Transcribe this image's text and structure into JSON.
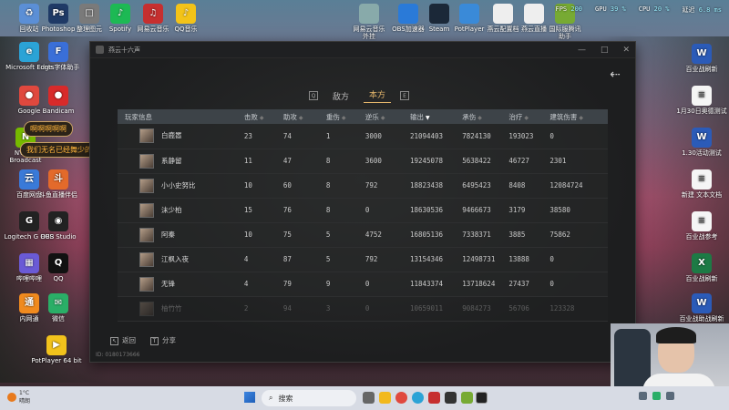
{
  "desktop_icons": [
    {
      "id": "recycle",
      "label": "回收站",
      "color": "#5b8fd6",
      "glyph": "♻"
    },
    {
      "id": "photoshop",
      "label": "Photoshop",
      "color": "#1f3a66",
      "glyph": "Ps"
    },
    {
      "id": "zhengli",
      "label": "整理图元",
      "color": "#7a7a7a",
      "glyph": "□"
    },
    {
      "id": "spotify",
      "label": "Spotify",
      "color": "#1db954",
      "glyph": "♪"
    },
    {
      "id": "netease",
      "label": "网易云音乐",
      "color": "#c62f2f",
      "glyph": "♫"
    },
    {
      "id": "qqmusic",
      "label": "QQ音乐",
      "color": "#f3c318",
      "glyph": "♪"
    },
    {
      "id": "edge",
      "label": "Microsoft Edge",
      "color": "#2ba3d6",
      "glyph": "e"
    },
    {
      "id": "fonts",
      "label": "Fonts字体助手",
      "color": "#3a6fd8",
      "glyph": "F"
    },
    {
      "id": "chrome",
      "label": "Google",
      "color": "#e0483e",
      "glyph": "●"
    },
    {
      "id": "bandicam",
      "label": "Bandicam",
      "color": "#d82a2a",
      "glyph": "●"
    },
    {
      "id": "nvidia",
      "label": "NVIDIA Broadcast",
      "color": "#76b900",
      "glyph": "N"
    },
    {
      "id": "baidu",
      "label": "百度网盘",
      "color": "#3a7ad8",
      "glyph": "云"
    },
    {
      "id": "mahjong",
      "label": "斗鱼直播伴侣",
      "color": "#e36a2b",
      "glyph": "斗"
    },
    {
      "id": "logitech",
      "label": "Logitech G HUB",
      "color": "#222",
      "glyph": "G"
    },
    {
      "id": "obs",
      "label": "OBS Studio",
      "color": "#222",
      "glyph": "◉"
    },
    {
      "id": "bilimini",
      "label": "哔哩哔哩",
      "color": "#6a5ad6",
      "glyph": "▦"
    },
    {
      "id": "qq",
      "label": "QQ",
      "color": "#111",
      "glyph": "Q"
    },
    {
      "id": "neijiang",
      "label": "内网通",
      "color": "#f08a1e",
      "glyph": "通"
    },
    {
      "id": "wechat",
      "label": "微信",
      "color": "#2aae67",
      "glyph": "✉"
    },
    {
      "id": "potplayer",
      "label": "PotPlayer 64 bit",
      "color": "#f2c21c",
      "glyph": "▶"
    }
  ],
  "top_bar_icons": [
    {
      "id": "tb1",
      "label": "网易云音乐外挂"
    },
    {
      "id": "tb2",
      "label": "OBS加速器"
    },
    {
      "id": "tb3",
      "label": "Steam"
    },
    {
      "id": "tb4",
      "label": "PotPlayer"
    },
    {
      "id": "tb5",
      "label": "燕云配置档"
    },
    {
      "id": "tb6",
      "label": "燕云直播"
    },
    {
      "id": "tb7",
      "label": "国际服腾讯助手"
    }
  ],
  "right_icons": [
    {
      "id": "r1",
      "label": "百业战刷新",
      "type": "word"
    },
    {
      "id": "r2",
      "label": "1月30日奥德测试",
      "type": "doc"
    },
    {
      "id": "r3",
      "label": "1.30活动测试",
      "type": "word"
    },
    {
      "id": "r4",
      "label": "新建 文本文档",
      "type": "doc"
    },
    {
      "id": "r5",
      "label": "百业战参考",
      "type": "doc"
    },
    {
      "id": "r6",
      "label": "百业战刷新",
      "type": "excel"
    },
    {
      "id": "r7",
      "label": "百业战助战刷新",
      "type": "word"
    }
  ],
  "sysstat": {
    "fps_label": "FPS",
    "fps": "200",
    "gpu_label": "GPU",
    "gpu": "39 %",
    "cpu_label": "CPU",
    "cpu": "20 %",
    "latency_label": "延迟",
    "latency": "6.8 ms"
  },
  "overlays": {
    "bubble1": "啊啊啊啊啊",
    "bubble2": "我们无名已经舞少的了"
  },
  "window": {
    "title": "燕云十六声",
    "minimize": "—",
    "maximize": "□",
    "close": "✕"
  },
  "tabs": {
    "key_left": "Q",
    "enemy": "敌方",
    "ours": "本方",
    "key_right": "E"
  },
  "table": {
    "headers": [
      "玩家信息",
      "击败",
      "助攻",
      "重伤",
      "逆乐",
      "输出",
      "承伤",
      "治疗",
      "建筑伤害"
    ],
    "rows": [
      {
        "name": "白鹿嚣",
        "kills": "23",
        "assists": "74",
        "downs": "1",
        "revive": "3000",
        "output": "21094403",
        "taken": "7824130",
        "heal": "193023",
        "building": "0"
      },
      {
        "name": "系静留",
        "kills": "11",
        "assists": "47",
        "downs": "8",
        "revive": "3600",
        "output": "19245078",
        "taken": "5638422",
        "heal": "46727",
        "building": "2301"
      },
      {
        "name": "小小史努比",
        "kills": "10",
        "assists": "60",
        "downs": "8",
        "revive": "792",
        "output": "18823438",
        "taken": "6495423",
        "heal": "8408",
        "building": "12084724"
      },
      {
        "name": "沫少柏",
        "kills": "15",
        "assists": "76",
        "downs": "8",
        "revive": "0",
        "output": "18630536",
        "taken": "9466673",
        "heal": "3179",
        "building": "38580"
      },
      {
        "name": "阿秦",
        "kills": "10",
        "assists": "75",
        "downs": "5",
        "revive": "4752",
        "output": "16805136",
        "taken": "7338371",
        "heal": "3885",
        "building": "75862"
      },
      {
        "name": "江枫入夜",
        "kills": "4",
        "assists": "87",
        "downs": "5",
        "revive": "792",
        "output": "13154346",
        "taken": "12498731",
        "heal": "13888",
        "building": "0"
      },
      {
        "name": "无锋",
        "kills": "4",
        "assists": "79",
        "downs": "9",
        "revive": "0",
        "output": "11843374",
        "taken": "13718624",
        "heal": "27437",
        "building": "0"
      },
      {
        "name": "柚竹竹",
        "kills": "2",
        "assists": "94",
        "downs": "3",
        "revive": "0",
        "output": "10659011",
        "taken": "9084273",
        "heal": "56706",
        "building": "123328"
      }
    ]
  },
  "bottom": {
    "back_key": "Esc",
    "back": "返回",
    "share_key": "T",
    "share": "分享",
    "game_id": "ID: 0180173666"
  },
  "taskbar": {
    "temp": "1°C",
    "weather": "晴朗",
    "search": "搜索"
  }
}
